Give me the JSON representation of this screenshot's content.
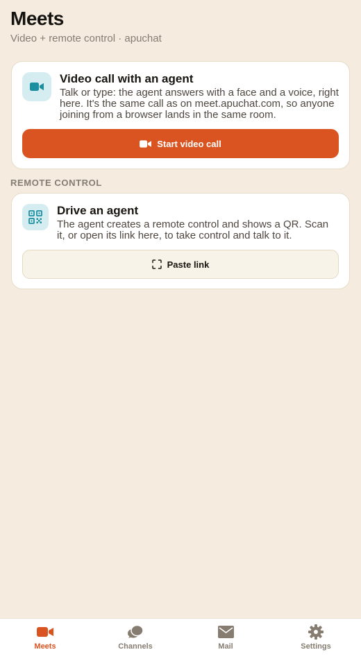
{
  "header": {
    "title": "Meets",
    "subtitle": "Video + remote control · apuchat"
  },
  "video_card": {
    "icon": "video-camera-icon",
    "title": "Video call with an agent",
    "description": "Talk or type: the agent answers with a face and a voice, right here. It's the same call as on meet.apuchat.com, so anyone joining from a browser lands in the same room.",
    "button_label": "Start video call"
  },
  "remote_section": {
    "label": "REMOTE CONTROL"
  },
  "remote_card": {
    "icon": "qr-code-icon",
    "title": "Drive an agent",
    "description": "The agent creates a remote control and shows a QR. Scan it, or open its link here, to take control and talk to it.",
    "button_label": "Paste link"
  },
  "tabbar": {
    "tabs": [
      {
        "label": "Meets",
        "icon": "video-camera-icon",
        "active": true
      },
      {
        "label": "Channels",
        "icon": "chat-bubbles-icon",
        "active": false
      },
      {
        "label": "Mail",
        "icon": "envelope-icon",
        "active": false
      },
      {
        "label": "Settings",
        "icon": "gear-icon",
        "active": false
      }
    ]
  },
  "colors": {
    "background": "#f5ecdf",
    "accent": "#d95420",
    "icon_tile": "#d5edf1",
    "icon_teal": "#1a8fa0",
    "muted": "#867c70"
  }
}
